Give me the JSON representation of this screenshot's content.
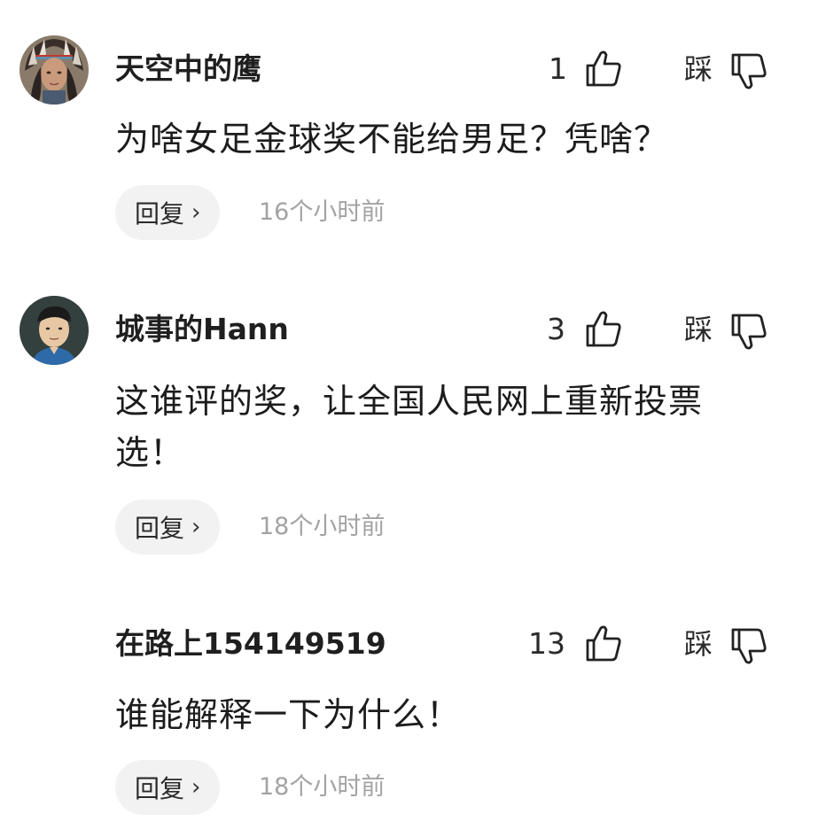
{
  "comments": [
    {
      "username": "天空中的鹰",
      "likes": "1",
      "dislike_label": "踩",
      "text": "为啥女足金球奖不能给男足？凭啥？",
      "reply_label": "回复",
      "timestamp": "16个小时前",
      "has_avatar": true
    },
    {
      "username": "城事的Hann",
      "likes": "3",
      "dislike_label": "踩",
      "text": "这谁评的奖，让全国人民网上重新投票选！",
      "reply_label": "回复",
      "timestamp": "18个小时前",
      "has_avatar": true
    },
    {
      "username": "在路上154149519",
      "likes": "13",
      "dislike_label": "踩",
      "text": "谁能解释一下为什么！",
      "reply_label": "回复",
      "timestamp": "18个小时前",
      "has_avatar": false
    }
  ],
  "icons": {
    "like": "thumbs-up-outline-icon",
    "dislike": "thumbs-down-outline-icon",
    "reply_chevron": "chevron-right-icon"
  }
}
